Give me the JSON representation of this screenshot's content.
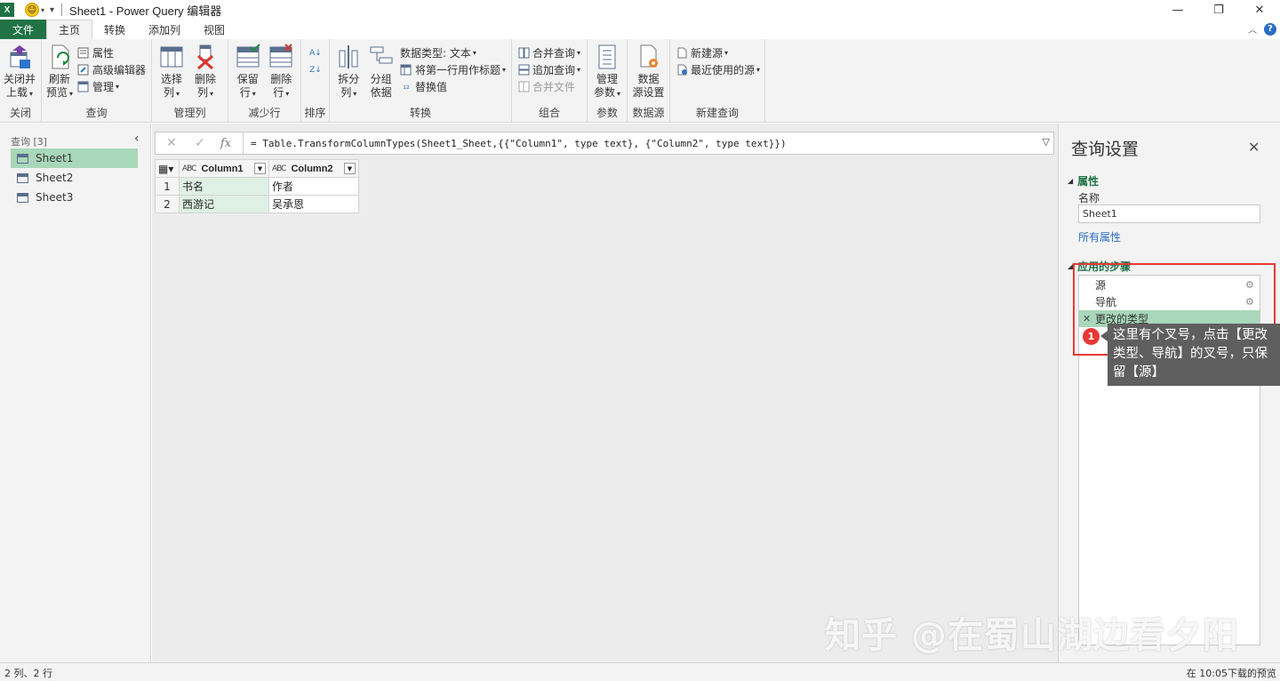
{
  "window": {
    "title": "Sheet1 - Power Query 编辑器",
    "controls": [
      "—",
      "❐",
      "✕"
    ]
  },
  "tabs": [
    {
      "label": "文件"
    },
    {
      "label": "主页"
    },
    {
      "label": "转换"
    },
    {
      "label": "添加列"
    },
    {
      "label": "视图"
    }
  ],
  "ribbon": {
    "close": {
      "btn": "关闭并",
      "btn2": "上载",
      "group": "关闭"
    },
    "query": {
      "refresh": "刷新",
      "refresh2": "预览",
      "properties": "属性",
      "advanced": "高级编辑器",
      "manage": "管理",
      "group": "查询"
    },
    "manage_cols": {
      "choose": "选择",
      "choose2": "列",
      "remove": "删除",
      "remove2": "列",
      "group": "管理列"
    },
    "reduce_rows": {
      "keep": "保留",
      "keep2": "行",
      "remove": "删除",
      "remove2": "行",
      "group": "减少行"
    },
    "sort": {
      "group": "排序"
    },
    "transform": {
      "split": "拆分",
      "split2": "列",
      "groupby": "分组",
      "groupby2": "依据",
      "datatype": "数据类型: 文本",
      "firstrow": "将第一行用作标题",
      "replace": "替换值",
      "group": "转换"
    },
    "combine": {
      "merge": "合并查询",
      "append": "追加查询",
      "combine_files": "合并文件",
      "group": "组合"
    },
    "params": {
      "manage": "管理",
      "manage2": "参数",
      "group": "参数"
    },
    "datasource": {
      "settings": "数据",
      "settings2": "源设置",
      "group": "数据源"
    },
    "newquery": {
      "newsource": "新建源",
      "recent": "最近使用的源",
      "group": "新建查询"
    }
  },
  "left_panel": {
    "header": "查询 [3]",
    "items": [
      {
        "label": "Sheet1"
      },
      {
        "label": "Sheet2"
      },
      {
        "label": "Sheet3"
      }
    ]
  },
  "formula_bar": {
    "text": "= Table.TransformColumnTypes(Sheet1_Sheet,{{\"Column1\", type text}, {\"Column2\", type text}})"
  },
  "grid": {
    "type_badge": "ABC",
    "columns": [
      "Column1",
      "Column2"
    ],
    "rows": [
      {
        "n": "1",
        "c1": "书名",
        "c2": "作者"
      },
      {
        "n": "2",
        "c1": "西游记",
        "c2": "吴承恩"
      }
    ]
  },
  "query_settings": {
    "title": "查询设置",
    "properties_heading": "属性",
    "name_label": "名称",
    "name_value": "Sheet1",
    "all_properties": "所有属性",
    "steps_heading": "应用的步骤",
    "steps": [
      {
        "label": "源"
      },
      {
        "label": "导航"
      },
      {
        "label": "更改的类型"
      }
    ]
  },
  "annotation": {
    "number": "1",
    "text": "这里有个叉号，点击【更改类型、导航】的叉号，只保留【源】"
  },
  "watermark": "知乎 @在蜀山湖边看夕阳",
  "status": {
    "left": "2 列、2 行",
    "right": "在 10:05下载的预览"
  },
  "colors": {
    "accent": "#217346",
    "selected": "#a8d7b9",
    "annotation": "#e53935"
  }
}
